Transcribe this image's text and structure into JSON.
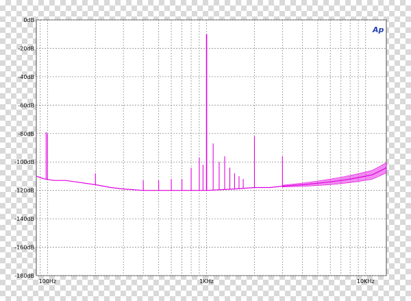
{
  "chart_data": {
    "type": "line",
    "title": "",
    "xlabel": "",
    "ylabel": "",
    "x_scale": "log",
    "xlim": [
      85,
      13500
    ],
    "ylim": [
      -180,
      0
    ],
    "grid": true,
    "x_ticks": [
      {
        "value": 100,
        "label": "100Hz"
      },
      {
        "value": 1000,
        "label": "1KHz"
      },
      {
        "value": 10000,
        "label": "10KHz"
      }
    ],
    "y_ticks": [
      {
        "value": 0,
        "label": "0dB"
      },
      {
        "value": -20,
        "label": "-20dB"
      },
      {
        "value": -40,
        "label": "-40dB"
      },
      {
        "value": -60,
        "label": "-60dB"
      },
      {
        "value": -80,
        "label": "-80dB"
      },
      {
        "value": -100,
        "label": "-100dB"
      },
      {
        "value": -120,
        "label": "-120dB"
      },
      {
        "value": -140,
        "label": "-140dB"
      },
      {
        "value": -160,
        "label": "-160dB"
      },
      {
        "value": -180,
        "label": "-180dB"
      }
    ],
    "series": [
      {
        "color": "#e000e0",
        "floor": [
          [
            85,
            -110
          ],
          [
            90,
            -111
          ],
          [
            96,
            -112
          ],
          [
            110,
            -113
          ],
          [
            130,
            -113
          ],
          [
            150,
            -114
          ],
          [
            200,
            -116
          ],
          [
            250,
            -118
          ],
          [
            300,
            -119
          ],
          [
            400,
            -120
          ],
          [
            500,
            -120
          ],
          [
            600,
            -120
          ],
          [
            700,
            -120
          ],
          [
            800,
            -120
          ],
          [
            1000,
            -120
          ],
          [
            1500,
            -119
          ],
          [
            2000,
            -118
          ],
          [
            2500,
            -118
          ],
          [
            3000,
            -117
          ],
          [
            4000,
            -116
          ],
          [
            5000,
            -115
          ],
          [
            6000,
            -114
          ],
          [
            7000,
            -113
          ],
          [
            8000,
            -112
          ],
          [
            9000,
            -111
          ],
          [
            10000,
            -110
          ],
          [
            11000,
            -109
          ],
          [
            12000,
            -107
          ],
          [
            13000,
            -105
          ],
          [
            13500,
            -104
          ]
        ],
        "peaks": [
          [
            98,
            -79
          ],
          [
            100,
            -80
          ],
          [
            200,
            -108
          ],
          [
            400,
            -113
          ],
          [
            500,
            -113
          ],
          [
            600,
            -112
          ],
          [
            700,
            -112
          ],
          [
            800,
            -104
          ],
          [
            900,
            -97
          ],
          [
            950,
            -102
          ],
          [
            1000,
            -10
          ],
          [
            1100,
            -87
          ],
          [
            1200,
            -100
          ],
          [
            1300,
            -96
          ],
          [
            1400,
            -104
          ],
          [
            1500,
            -108
          ],
          [
            1600,
            -110
          ],
          [
            1700,
            -112
          ],
          [
            2000,
            -82
          ],
          [
            3000,
            -96
          ]
        ]
      }
    ]
  },
  "badge": {
    "text": "Ap",
    "color": "#1f3fae"
  }
}
